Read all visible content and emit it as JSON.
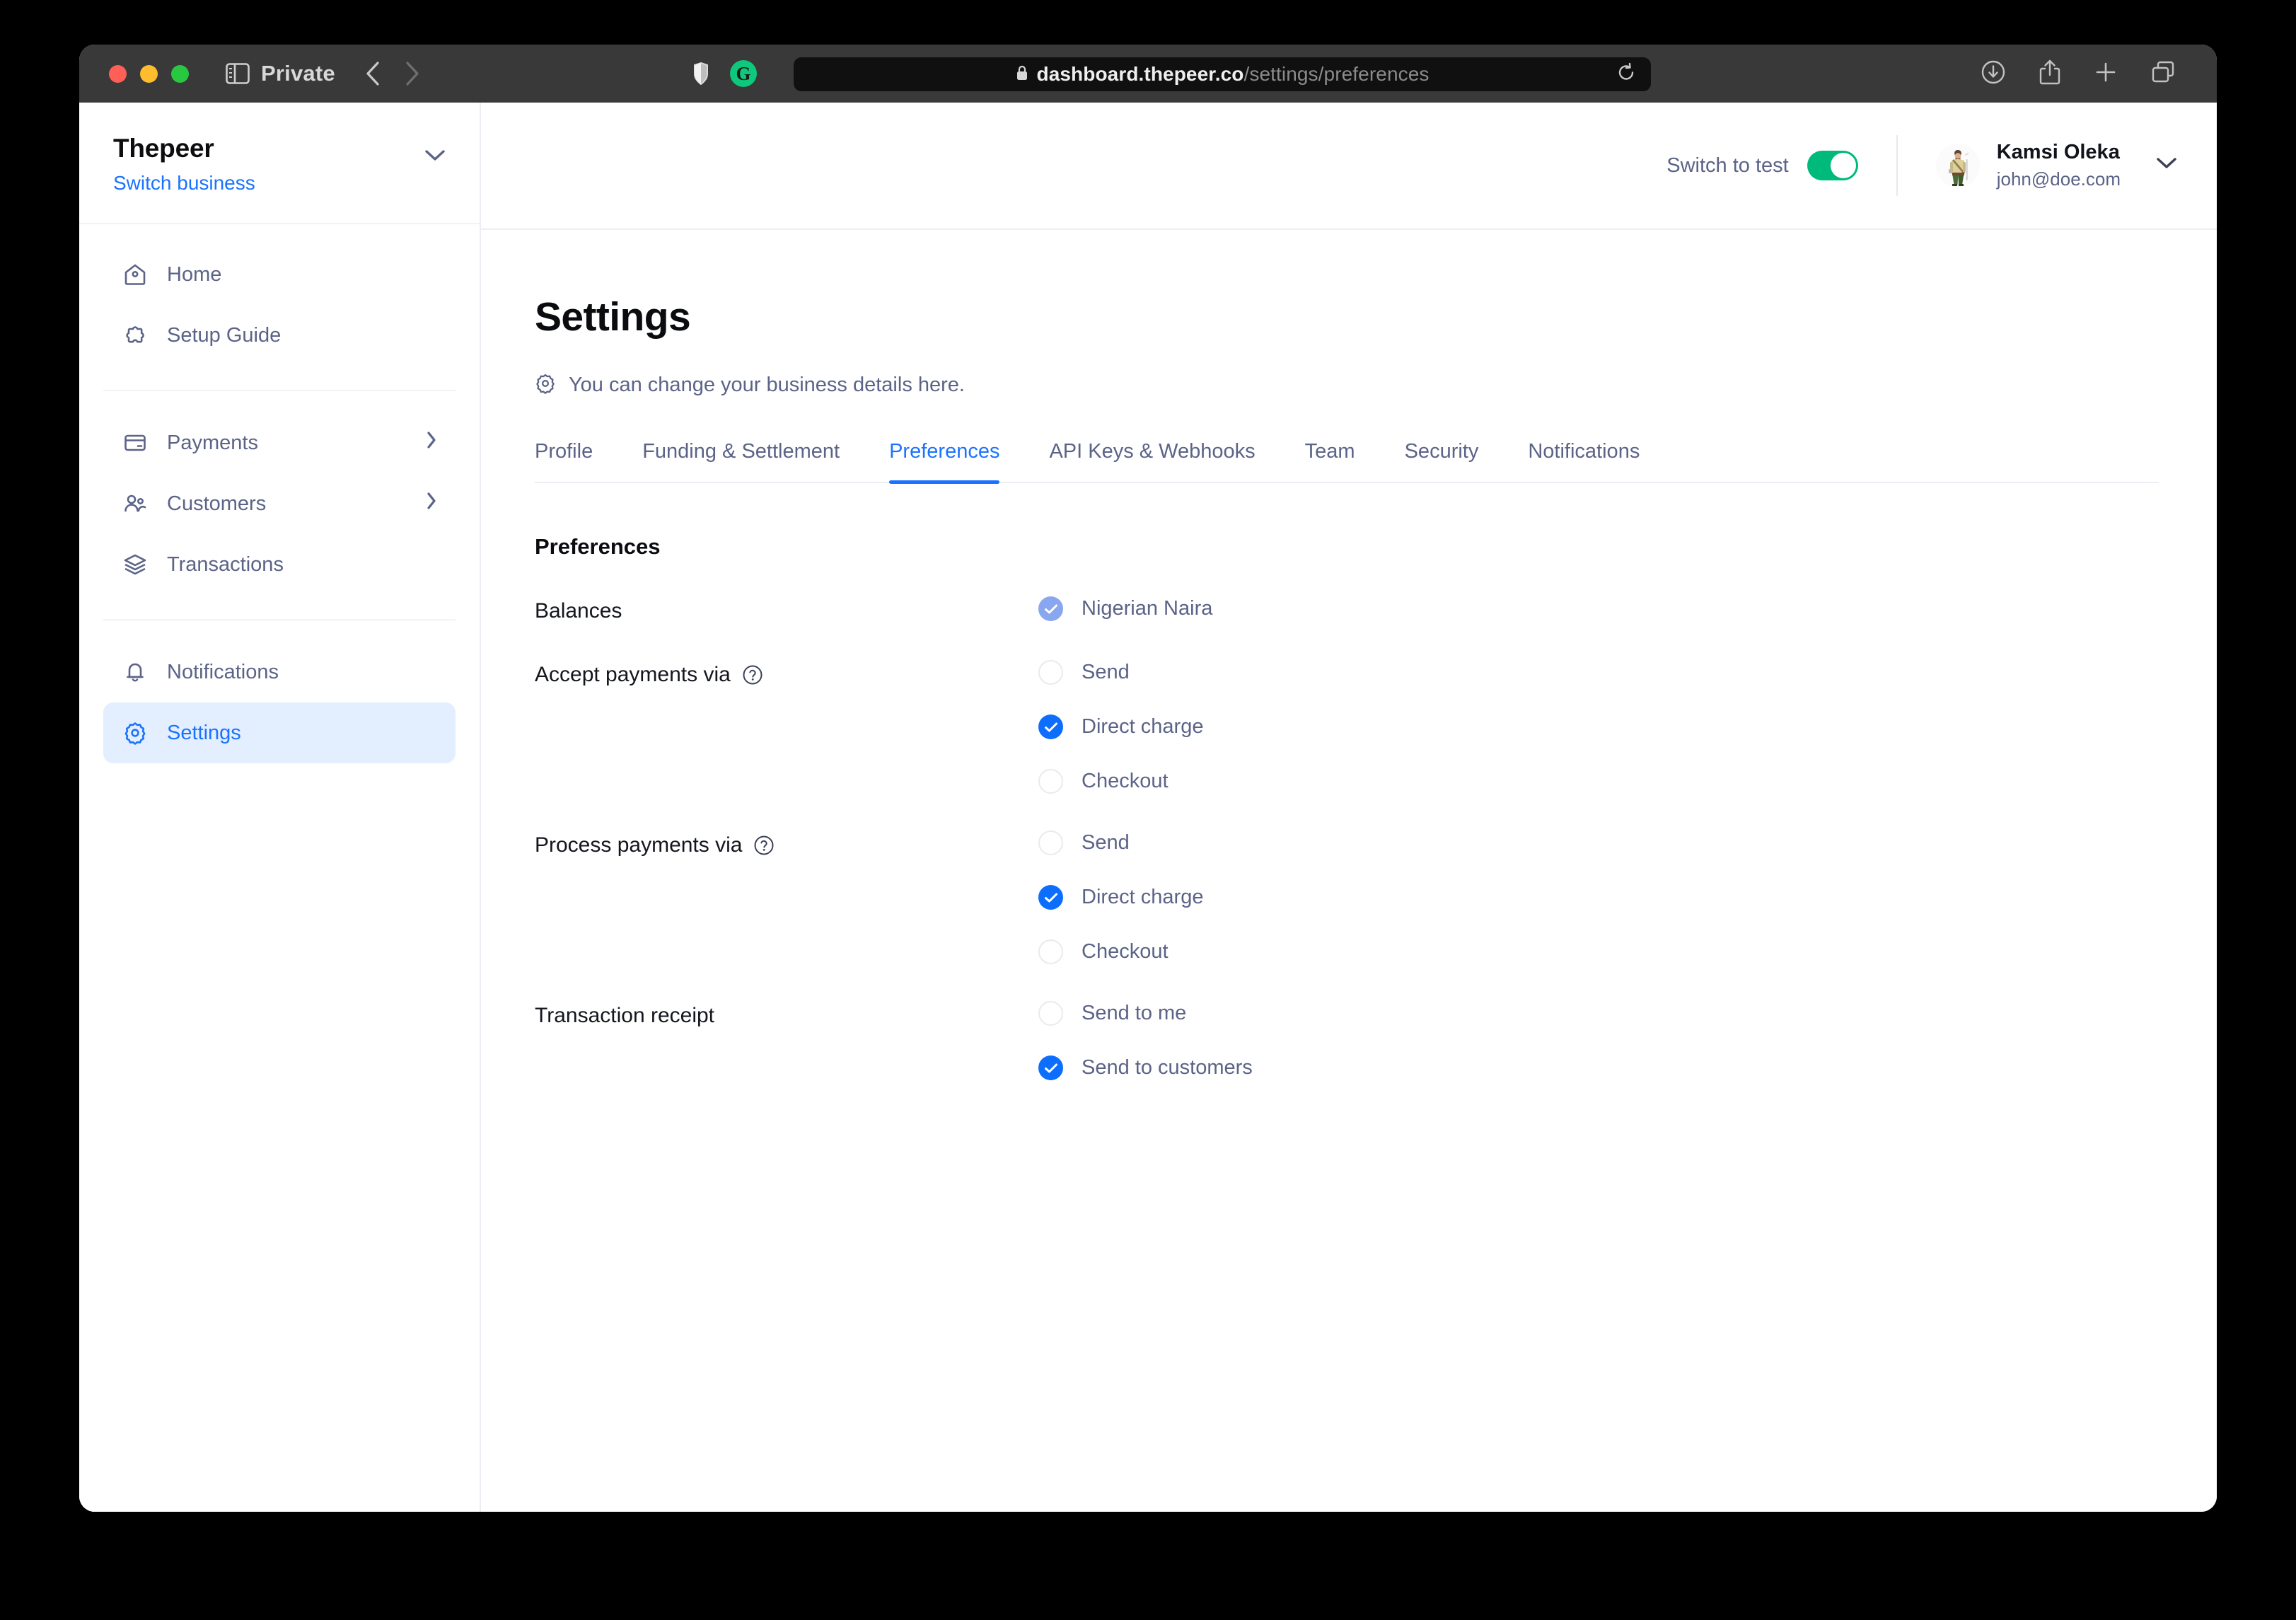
{
  "browser": {
    "window_mode_label": "Private",
    "url_host": "dashboard.thepeer.co",
    "url_path": "/settings/preferences",
    "icons": {
      "sidebar": "sidebar-toggle-icon",
      "back": "back-arrow-icon",
      "forward": "forward-arrow-icon",
      "shield": "shield-icon",
      "extension": "grammarly-extension-icon",
      "lock": "lock-icon",
      "reload": "reload-icon",
      "download": "download-icon",
      "share": "share-icon",
      "new_tab": "plus-icon",
      "tab_overview": "tab-overview-icon"
    }
  },
  "sidebar": {
    "business_name": "Thepeer",
    "switch_business_label": "Switch business",
    "groups": [
      {
        "items": [
          {
            "label": "Home",
            "icon": "home-icon",
            "active": false,
            "chevron": false
          },
          {
            "label": "Setup Guide",
            "icon": "puzzle-icon",
            "active": false,
            "chevron": false
          }
        ]
      },
      {
        "items": [
          {
            "label": "Payments",
            "icon": "credit-card-icon",
            "active": false,
            "chevron": true
          },
          {
            "label": "Customers",
            "icon": "users-icon",
            "active": false,
            "chevron": true
          },
          {
            "label": "Transactions",
            "icon": "layers-icon",
            "active": false,
            "chevron": false
          }
        ]
      },
      {
        "items": [
          {
            "label": "Notifications",
            "icon": "bell-icon",
            "active": false,
            "chevron": false
          },
          {
            "label": "Settings",
            "icon": "gear-icon",
            "active": true,
            "chevron": false
          }
        ]
      }
    ]
  },
  "topbar": {
    "switch_label": "Switch to test",
    "switch_on": true,
    "switch_color": "#00ba7c",
    "user_name": "Kamsi Oleka",
    "user_email": "john@doe.com"
  },
  "page": {
    "title": "Settings",
    "subtitle": "You can change your business details here.",
    "subtitle_icon": "gear-icon"
  },
  "tabs": [
    {
      "label": "Profile",
      "active": false
    },
    {
      "label": "Funding & Settlement",
      "active": false
    },
    {
      "label": "Preferences",
      "active": true
    },
    {
      "label": "API Keys & Webhooks",
      "active": false
    },
    {
      "label": "Team",
      "active": false
    },
    {
      "label": "Security",
      "active": false
    },
    {
      "label": "Notifications",
      "active": false
    }
  ],
  "preferences": {
    "section_title": "Preferences",
    "accent_color": "#1a73ff",
    "rows": [
      {
        "label": "Balances",
        "help": false,
        "options": [
          {
            "label": "Nigerian Naira",
            "state": "checked-light"
          }
        ]
      },
      {
        "label": "Accept payments via",
        "help": true,
        "options": [
          {
            "label": "Send",
            "state": "unchecked"
          },
          {
            "label": "Direct charge",
            "state": "checked"
          },
          {
            "label": "Checkout",
            "state": "unchecked"
          }
        ]
      },
      {
        "label": "Process payments via",
        "help": true,
        "options": [
          {
            "label": "Send",
            "state": "unchecked"
          },
          {
            "label": "Direct charge",
            "state": "checked"
          },
          {
            "label": "Checkout",
            "state": "unchecked"
          }
        ]
      },
      {
        "label": "Transaction receipt",
        "help": false,
        "options": [
          {
            "label": "Send to me",
            "state": "unchecked"
          },
          {
            "label": "Send to customers",
            "state": "checked"
          }
        ]
      }
    ]
  }
}
